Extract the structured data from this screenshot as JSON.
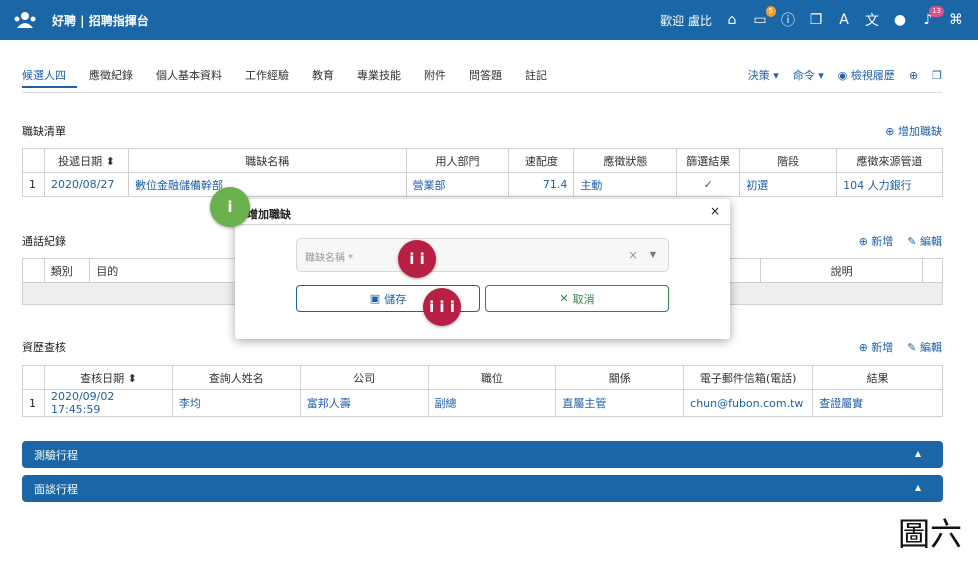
{
  "header": {
    "logo": "people-logo-icon",
    "title": "好聘 | 招聘指揮台",
    "welcome": "歡迎 盧比",
    "badges": {
      "inbox": "5",
      "notifications": "13"
    },
    "icons": [
      "home-icon",
      "inbox-icon",
      "info-icon",
      "window-icon",
      "font-icon",
      "translate-icon",
      "user-icon",
      "bell-icon",
      "command-icon"
    ]
  },
  "tabs": [
    "候選人四",
    "應徵紀錄",
    "個人基本資料",
    "工作經驗",
    "教育",
    "專業技能",
    "附件",
    "問答題",
    "註記"
  ],
  "tools": {
    "decision": "決策",
    "command": "命令",
    "view_history": "檢視履歷"
  },
  "vacancies": {
    "title": "職缺清單",
    "add_label": "增加職缺",
    "columns": [
      "投遞日期",
      "職缺名稱",
      "用人部門",
      "速配度",
      "應徵狀態",
      "篩選結果",
      "階段",
      "應徵來源管道"
    ],
    "rows": [
      {
        "idx": "1",
        "date": "2020/08/27",
        "name": "數位金融儲備幹部",
        "dept": "營業部",
        "match": "71.4",
        "status": "主動",
        "result": "✓",
        "stage": "初選",
        "source": "104 人力銀行"
      }
    ]
  },
  "calls": {
    "title": "通話紀錄",
    "add": "新增",
    "edit": "編輯",
    "columns": [
      "類別",
      "目的",
      "說明"
    ]
  },
  "checks": {
    "title": "資歷查核",
    "add": "新增",
    "edit": "編輯",
    "columns": [
      "查核日期",
      "查詢人姓名",
      "公司",
      "職位",
      "關係",
      "電子郵件信箱(電話)",
      "結果"
    ],
    "rows": [
      {
        "idx": "1",
        "date": "2020/09/02 17:45:59",
        "person": "李均",
        "company": "富邦人壽",
        "position": "副總",
        "relation": "直屬主管",
        "email": "chun@fubon.com.tw",
        "result": "查證屬實"
      }
    ]
  },
  "modal": {
    "title": "增加職缺",
    "placeholder": "職缺名稱 *",
    "save": "儲存",
    "cancel": "取消"
  },
  "markers": [
    "i",
    "i i",
    "i i i"
  ],
  "bars": [
    "測驗行程",
    "面談行程"
  ],
  "figure_label": "圖六"
}
